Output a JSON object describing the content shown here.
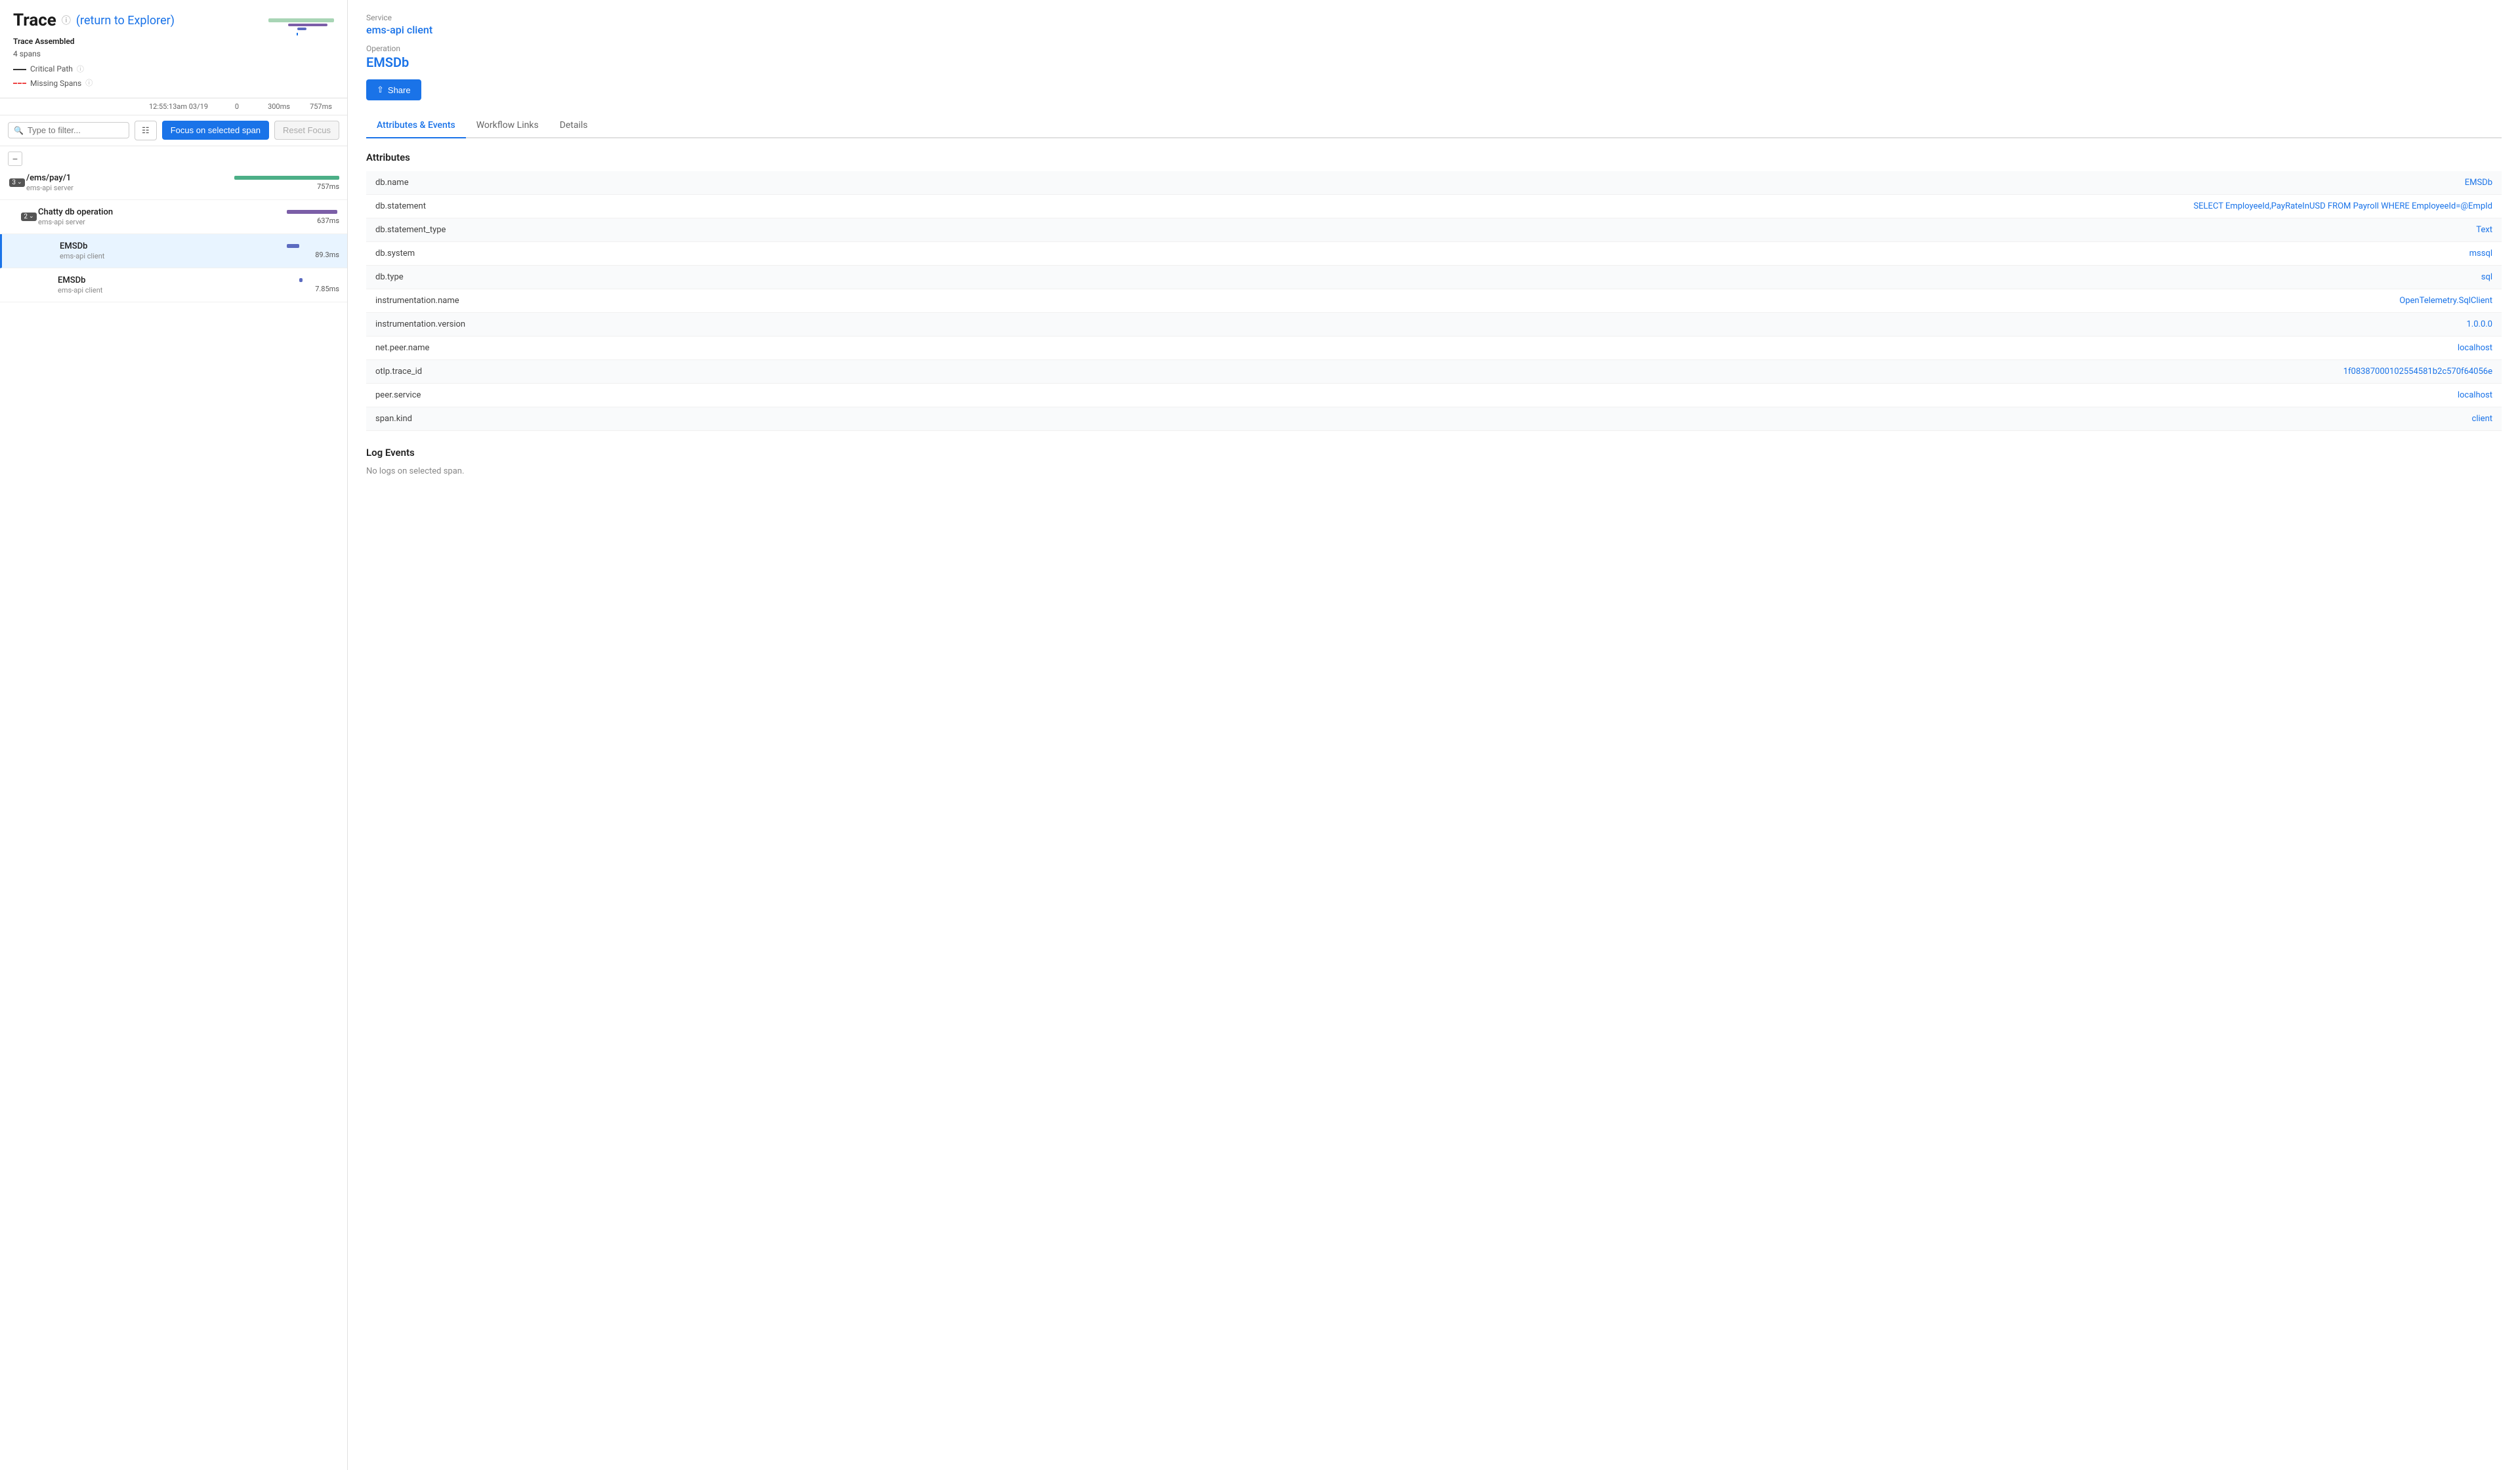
{
  "leftPanel": {
    "title": "Trace",
    "returnLink": "(return to Explorer)",
    "assembled": "Trace Assembled",
    "spans_count": "4 spans",
    "legend": [
      {
        "type": "solid",
        "label": "Critical Path"
      },
      {
        "type": "dashed",
        "label": "Missing Spans"
      }
    ],
    "timeline": {
      "start": "12:55:13am 03/19",
      "marks": [
        "0",
        "300ms",
        "757ms"
      ]
    },
    "toolbar": {
      "search_placeholder": "Type to filter...",
      "focus_label": "Focus on selected span",
      "reset_label": "Reset Focus"
    },
    "spans": [
      {
        "id": "root",
        "name": "/ems/pay/1",
        "service": "ems-api server",
        "duration": "757ms",
        "indent": 0,
        "expander": "3",
        "bar_left": "0%",
        "bar_width": "100%",
        "bar_color": "#4caf87",
        "selected": false,
        "collapsible": true
      },
      {
        "id": "chatty",
        "name": "Chatty db operation",
        "service": "ems-api server",
        "duration": "637ms",
        "indent": 1,
        "expander": "2",
        "bar_left": "50%",
        "bar_width": "48%",
        "bar_color": "#7b5ea7",
        "selected": false
      },
      {
        "id": "emsdb1",
        "name": "EMSDb",
        "service": "ems-api client",
        "duration": "89.3ms",
        "indent": 2,
        "expander": null,
        "bar_left": "50%",
        "bar_width": "12%",
        "bar_color": "#5c6bc0",
        "selected": true
      },
      {
        "id": "emsdb2",
        "name": "EMSDb",
        "service": "ems-api client",
        "duration": "7.85ms",
        "indent": 2,
        "expander": null,
        "bar_left": "63%",
        "bar_width": "3%",
        "bar_color": "#5c6bc0",
        "selected": false
      }
    ]
  },
  "rightPanel": {
    "service_label": "Service",
    "service_value": "ems-api client",
    "operation_label": "Operation",
    "operation_value": "EMSDb",
    "share_label": "Share",
    "tabs": [
      {
        "id": "attributes",
        "label": "Attributes & Events",
        "active": true
      },
      {
        "id": "workflow",
        "label": "Workflow Links",
        "active": false
      },
      {
        "id": "details",
        "label": "Details",
        "active": false
      }
    ],
    "attributes_title": "Attributes",
    "attributes": [
      {
        "key": "db.name",
        "value": "EMSDb"
      },
      {
        "key": "db.statement",
        "value": "SELECT EmployeeId,PayRateInUSD FROM Payroll WHERE EmployeeId=@EmpId"
      },
      {
        "key": "db.statement_type",
        "value": "Text"
      },
      {
        "key": "db.system",
        "value": "mssql"
      },
      {
        "key": "db.type",
        "value": "sql"
      },
      {
        "key": "instrumentation.name",
        "value": "OpenTelemetry.SqlClient"
      },
      {
        "key": "instrumentation.version",
        "value": "1.0.0.0"
      },
      {
        "key": "net.peer.name",
        "value": "localhost"
      },
      {
        "key": "otlp.trace_id",
        "value": "1f08387000102554581b2c570f64056e"
      },
      {
        "key": "peer.service",
        "value": "localhost"
      },
      {
        "key": "span.kind",
        "value": "client"
      }
    ],
    "log_events_title": "Log Events",
    "log_empty": "No logs on selected span."
  }
}
